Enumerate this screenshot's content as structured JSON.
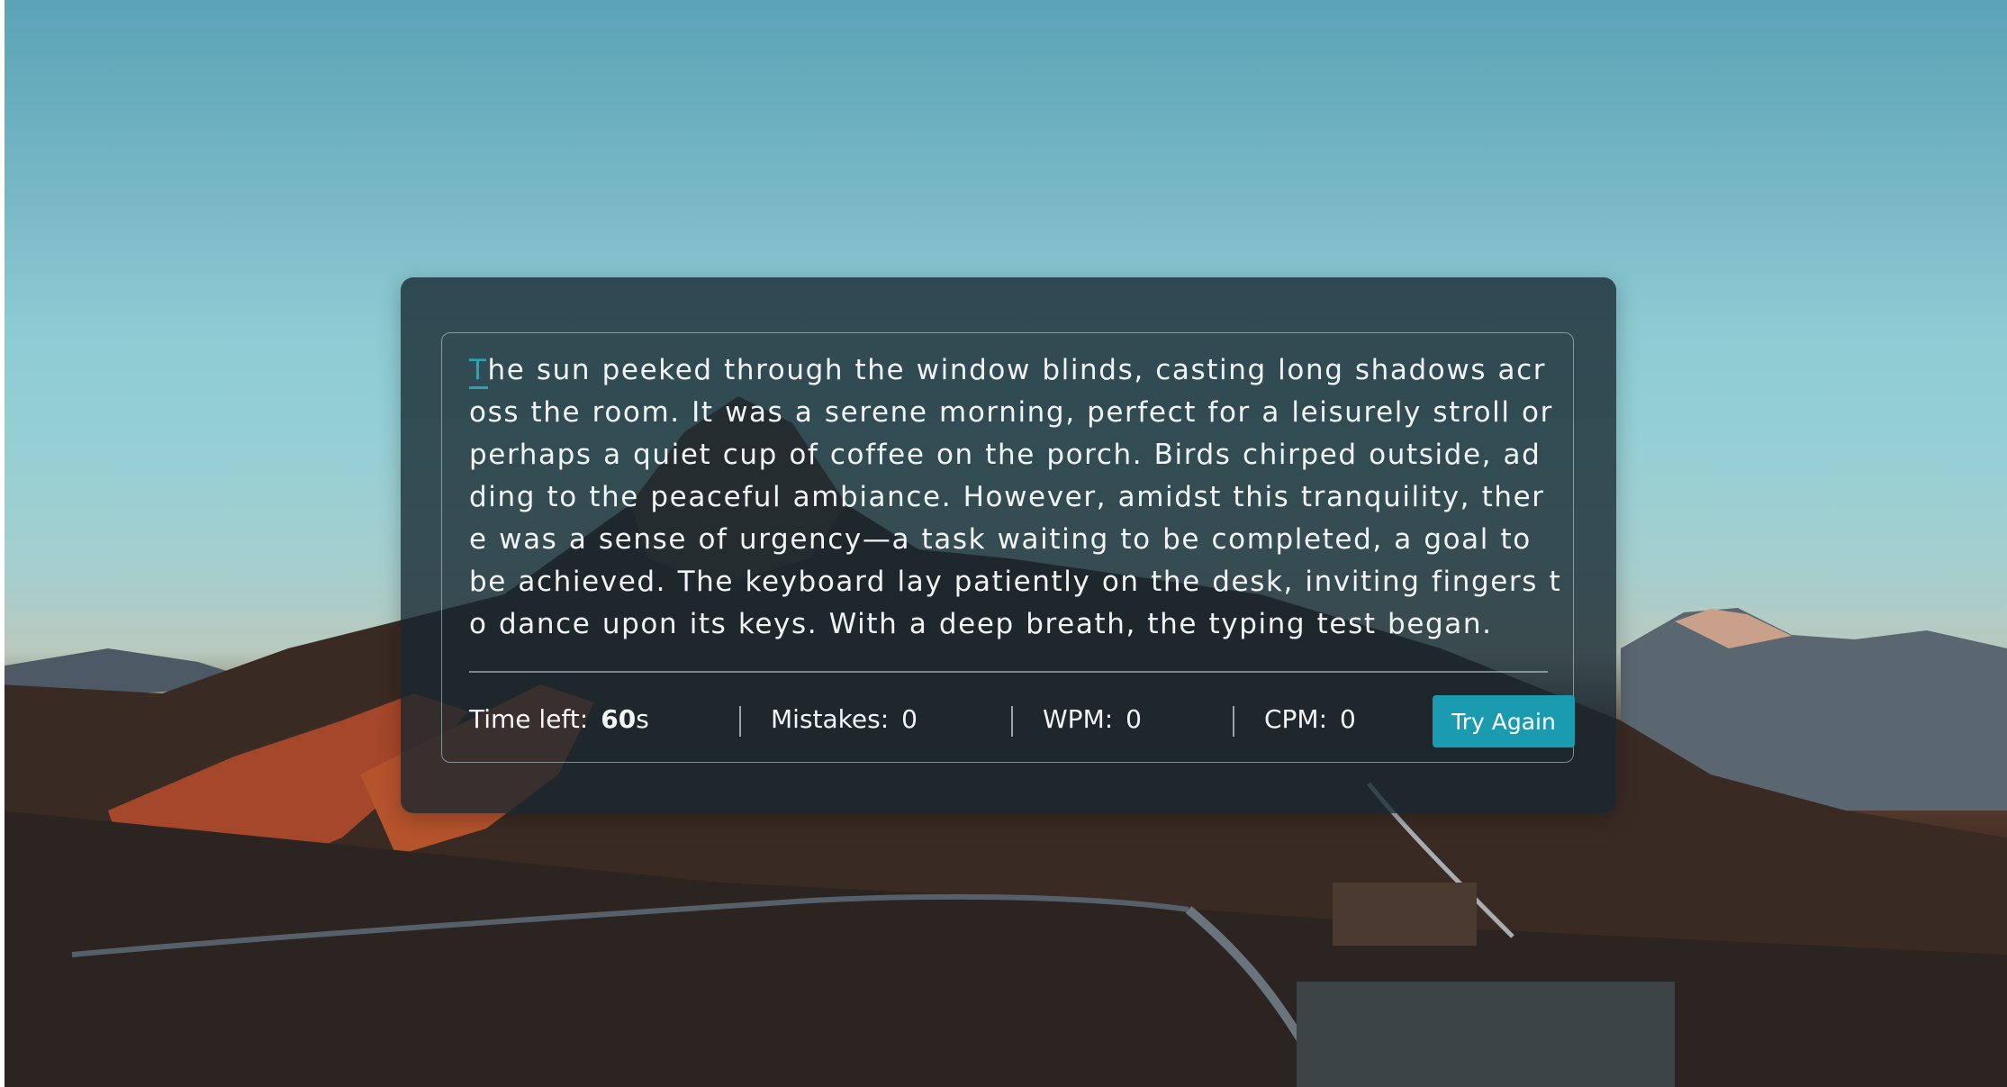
{
  "typing_test": {
    "cursor_char": "T",
    "lines": [
      "he sun peeked through the window blinds, casting long shadows acr",
      "oss the room. It was a serene morning, perfect for a leisurely stroll or",
      "perhaps a quiet cup of coffee on the porch. Birds chirped outside, ad",
      "ding to the peaceful ambiance. However, amidst this tranquility, ther",
      "e was a sense of urgency—a task waiting to be completed, a goal to",
      "be achieved. The keyboard lay patiently on the desk, inviting fingers t",
      "o dance upon its keys. With a deep breath, the typing test began."
    ]
  },
  "stats": {
    "time_label": "Time left:",
    "time_value": "60",
    "time_unit": "s",
    "mistakes_label": "Mistakes:",
    "mistakes_value": "0",
    "wpm_label": "WPM:",
    "wpm_value": "0",
    "cpm_label": "CPM:",
    "cpm_value": "0"
  },
  "button": {
    "try_again_label": "Try Again"
  },
  "colors": {
    "accent": "#1a9bb0",
    "cursor": "#29a3b8",
    "text": "#f2f4f4"
  }
}
